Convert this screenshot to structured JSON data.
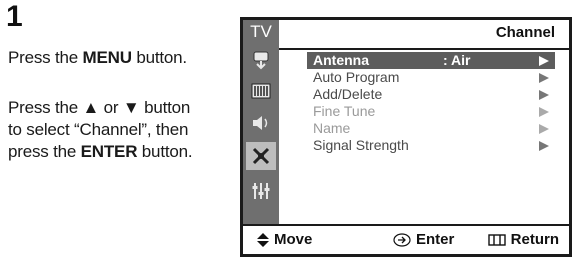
{
  "step": {
    "number": "1",
    "line1_a": "Press the ",
    "line1_b": "MENU",
    "line1_c": " button.",
    "line2_a": "Press the ▲ or ▼ button",
    "line2_b": "to select “Channel”, then",
    "line2_c": "press the ",
    "line2_d": "ENTER",
    "line2_e": " button."
  },
  "osd": {
    "sidebar_label": "TV",
    "sidebar_icons": [
      "input-icon",
      "picture-icon",
      "sound-icon",
      "channel-icon",
      "setup-icon"
    ],
    "title": "Channel",
    "items": [
      {
        "label": "Antenna",
        "value": ":  Air",
        "state": "selected"
      },
      {
        "label": "Auto Program",
        "value": "",
        "state": "normal"
      },
      {
        "label": "Add/Delete",
        "value": "",
        "state": "normal"
      },
      {
        "label": "Fine Tune",
        "value": "",
        "state": "dim"
      },
      {
        "label": "Name",
        "value": "",
        "state": "dim"
      },
      {
        "label": "Signal Strength",
        "value": "",
        "state": "normal"
      }
    ],
    "footer": {
      "move": "Move",
      "enter": "Enter",
      "return": "Return"
    }
  }
}
